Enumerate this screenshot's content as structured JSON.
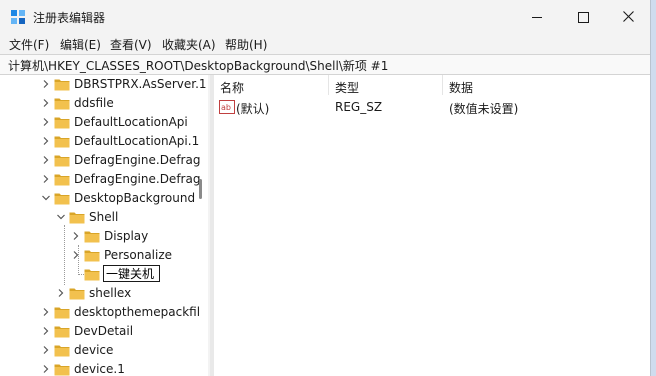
{
  "window": {
    "title": "注册表编辑器",
    "minimize_icon": "minimize-icon",
    "maximize_icon": "maximize-icon",
    "close_icon": "close-icon"
  },
  "menu": {
    "file": "文件(F)",
    "edit": "编辑(E)",
    "view": "查看(V)",
    "favorites": "收藏夹(A)",
    "help": "帮助(H)"
  },
  "address": {
    "path": "计算机\\HKEY_CLASSES_ROOT\\DesktopBackground\\Shell\\新项 #1"
  },
  "tree": {
    "items": [
      {
        "label": "DBRSTPRX.AsServer.1",
        "expanded": false
      },
      {
        "label": "ddsfile",
        "expanded": false
      },
      {
        "label": "DefaultLocationApi",
        "expanded": false
      },
      {
        "label": "DefaultLocationApi.1",
        "expanded": false
      },
      {
        "label": "DefragEngine.Defrag",
        "expanded": false
      },
      {
        "label": "DefragEngine.Defrag",
        "expanded": false
      },
      {
        "label": "DesktopBackground",
        "expanded": true
      },
      {
        "label": "Shell",
        "expanded": true
      },
      {
        "label": "Display",
        "expanded": false
      },
      {
        "label": "Personalize",
        "expanded": false
      },
      {
        "label": "",
        "editing": true
      },
      {
        "label": "shellex",
        "expanded": false
      },
      {
        "label": "desktopthemepackfil",
        "expanded": false
      },
      {
        "label": "DevDetail",
        "expanded": false
      },
      {
        "label": "device",
        "expanded": false
      },
      {
        "label": "device.1",
        "expanded": false
      }
    ],
    "rename_value": "一键关机"
  },
  "list": {
    "headers": {
      "name": "名称",
      "type": "类型",
      "data": "数据"
    },
    "rows": [
      {
        "name": "(默认)",
        "type": "REG_SZ",
        "data": "(数值未设置)"
      }
    ]
  },
  "colors": {
    "folder": "#f2c14e",
    "folder_dark": "#d9a528",
    "accent": "#0067c0"
  }
}
